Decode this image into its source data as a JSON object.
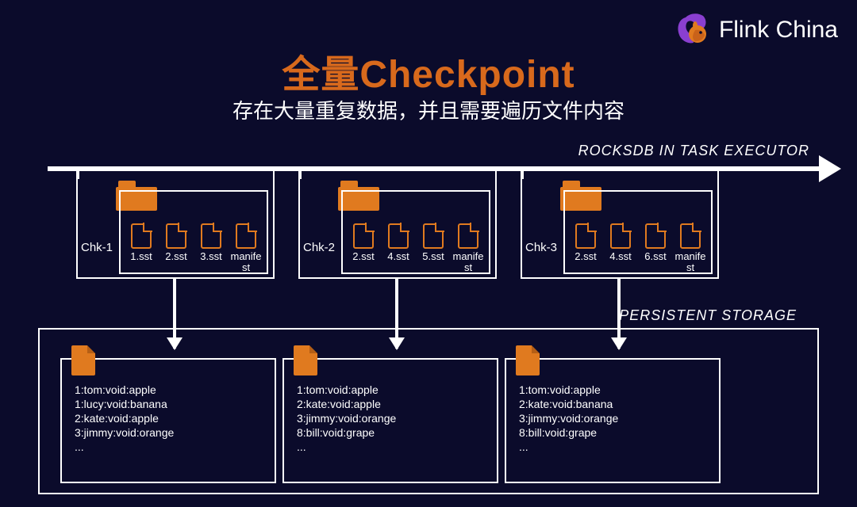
{
  "logo_text": "Flink China",
  "title": "全量Checkpoint",
  "subtitle": "存在大量重复数据，并且需要遍历文件内容",
  "rocksdb_label": "ROCKSDB IN TASK EXECUTOR",
  "persistent_label": "PERSISTENT STORAGE",
  "checkpoints": [
    {
      "label": "Chk-1",
      "files": [
        "1.sst",
        "2.sst",
        "3.sst",
        "manifest"
      ]
    },
    {
      "label": "Chk-2",
      "files": [
        "2.sst",
        "4.sst",
        "5.sst",
        "manifest"
      ]
    },
    {
      "label": "Chk-3",
      "files": [
        "2.sst",
        "4.sst",
        "6.sst",
        "manifest"
      ]
    }
  ],
  "storage": [
    {
      "lines": "1:tom:void:apple\n1:lucy:void:banana\n2:kate:void:apple\n3:jimmy:void:orange\n..."
    },
    {
      "lines": "1:tom:void:apple\n2:kate:void:apple\n3:jimmy:void:orange\n8:bill:void:grape\n..."
    },
    {
      "lines": "1:tom:void:apple\n2:kate:void:banana\n3:jimmy:void:orange\n8:bill:void:grape\n..."
    }
  ]
}
